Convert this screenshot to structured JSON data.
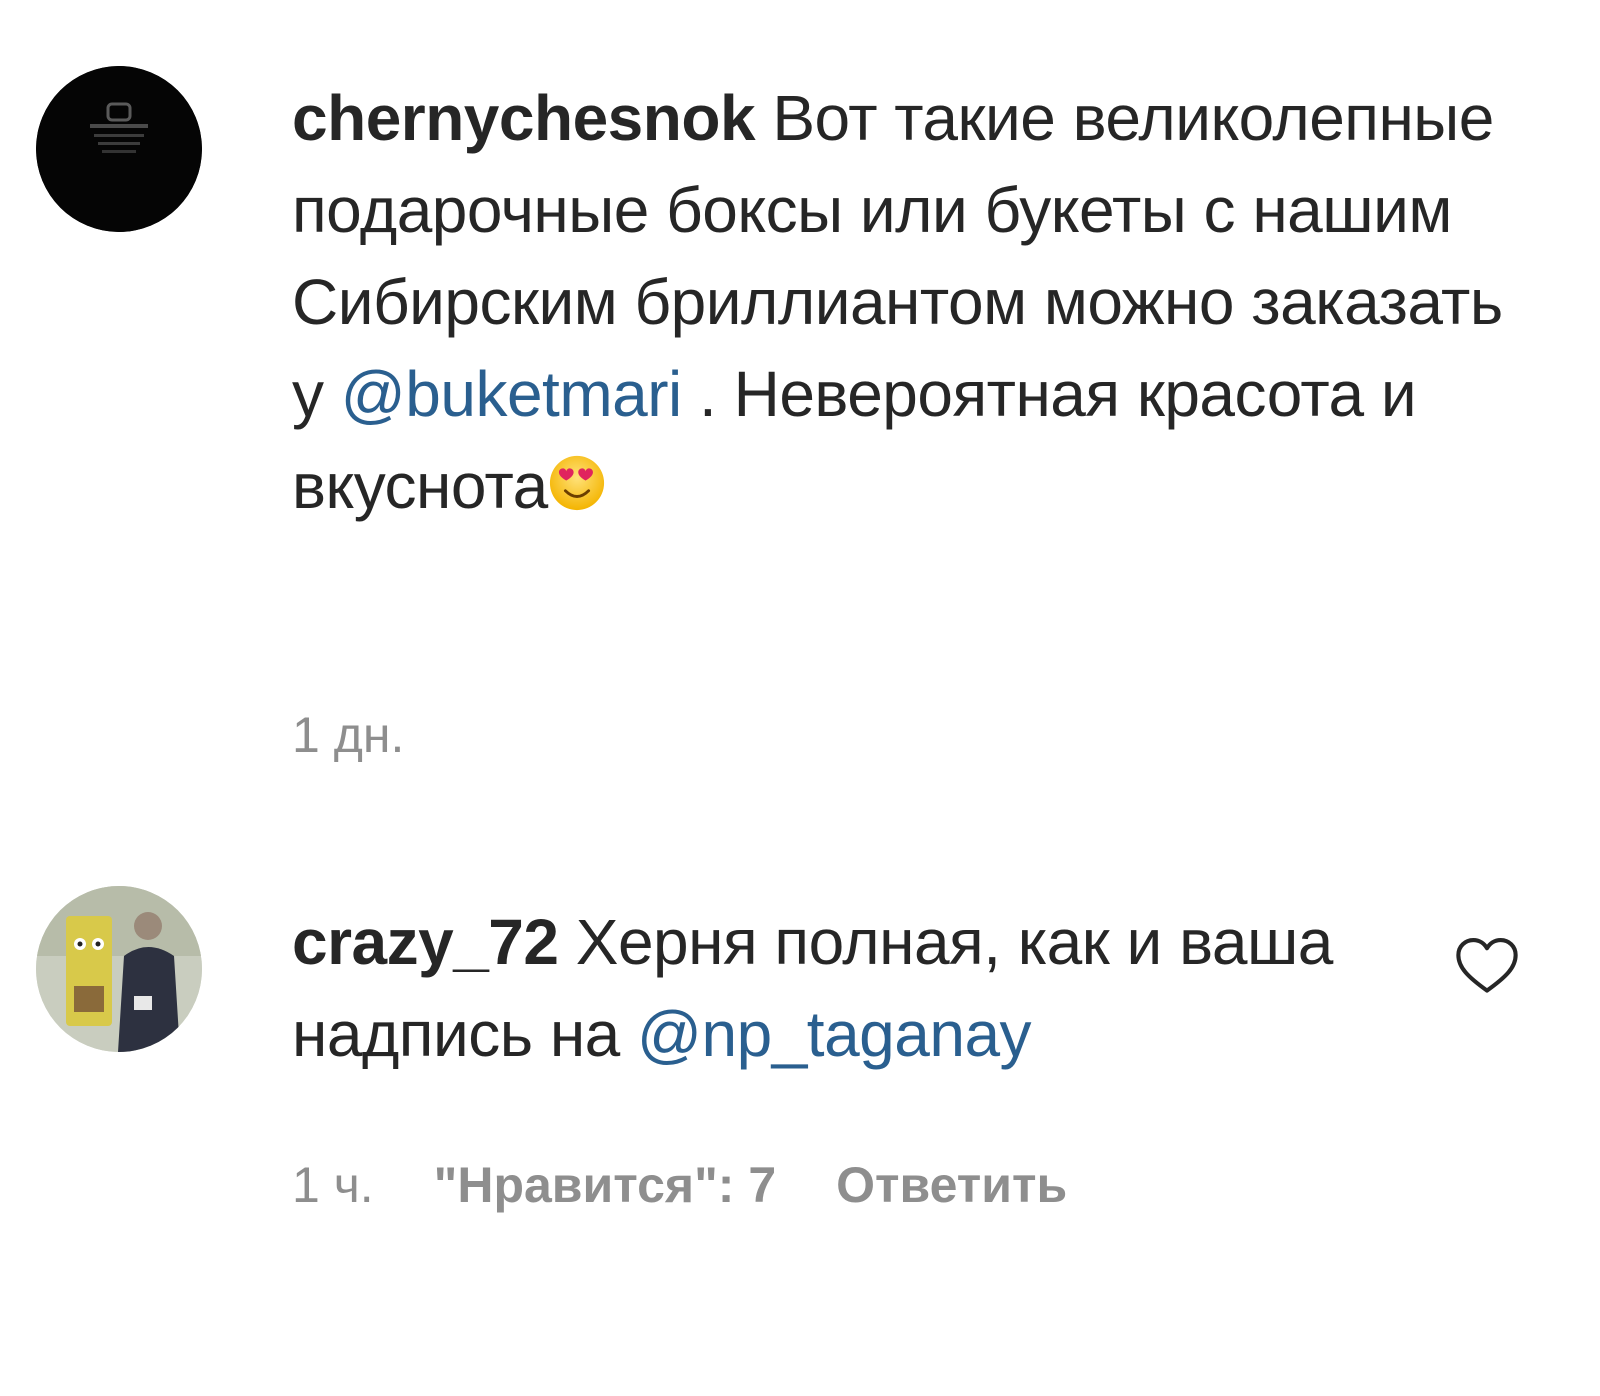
{
  "comments": [
    {
      "username": "chernychesnok",
      "text_before": " Вот такие великолепные подарочные боксы или букеты с нашим Сибирским бриллиантом можно заказать у ",
      "mention": "@buketmari",
      "text_after": " . Невероятная красота и вкуснота",
      "emoji": "smiling-face-with-heart-eyes",
      "time": "1 дн."
    },
    {
      "username": "crazy_72",
      "text_before": " Херня полная, как и ваша надпись на ",
      "mention": "@np_taganay",
      "text_after": "",
      "time": "1 ч.",
      "likes": "\"Нравится\": 7",
      "reply": "Ответить",
      "icon": "heart-outline"
    }
  ],
  "colors": {
    "text": "#262626",
    "meta": "#8e8e8e",
    "mention": "#2a5f8f"
  }
}
